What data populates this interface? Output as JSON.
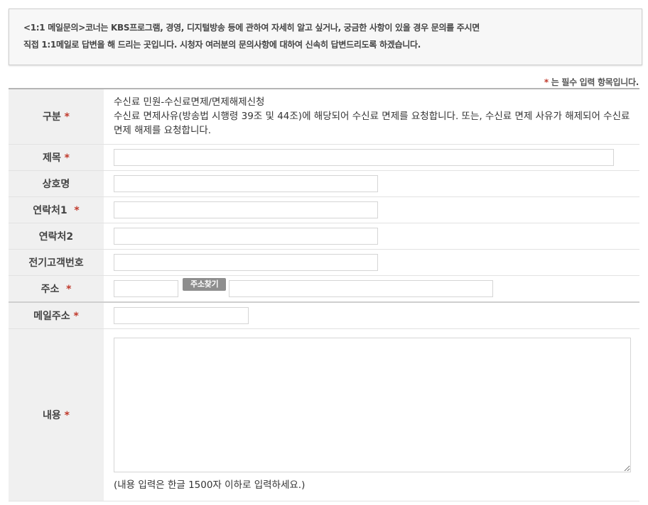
{
  "notice": {
    "line1": "<1:1 메일문의>코너는 KBS프로그램, 경영, 디지털방송 등에 관하여 자세히 알고 싶거나, 궁금한 사항이 있을 경우 문의를 주시면",
    "line2": "직접 1:1메일로 답변을 해 드리는 곳입니다. 시청자 여러분의 문의사항에  대하여 신속히 답변드리도록 하겠습니다."
  },
  "required_note": {
    "star": "*",
    "text": " 는 필수 입력 항목입니다."
  },
  "required_mark": "*",
  "form": {
    "category": {
      "label": "구분",
      "line1": "수신료 민원-수신료면제/면제해제신청",
      "line2": "수신료 면제사유(방송법 시행령 39조 및 44조)에 해당되어 수신료 면제를 요청합니다. 또는, 수신료 면제 사유가 해제되어 수신료 면제 해제를 요청합니다."
    },
    "title": {
      "label": "제목",
      "value": ""
    },
    "company": {
      "label": "상호명",
      "value": ""
    },
    "contact1": {
      "label": "연락처1",
      "value": ""
    },
    "contact2": {
      "label": "연락처2",
      "value": ""
    },
    "customer_no": {
      "label": "전기고객번호",
      "value": ""
    },
    "address": {
      "label": "주소",
      "zip_value": "",
      "button_label": "주소찾기",
      "detail_value": ""
    },
    "email": {
      "label": "메일주소",
      "value": ""
    },
    "content": {
      "label": "내용",
      "value": "",
      "hint": "(내용 입력은 한글 1500자 이하로 입력하세요.)"
    }
  }
}
